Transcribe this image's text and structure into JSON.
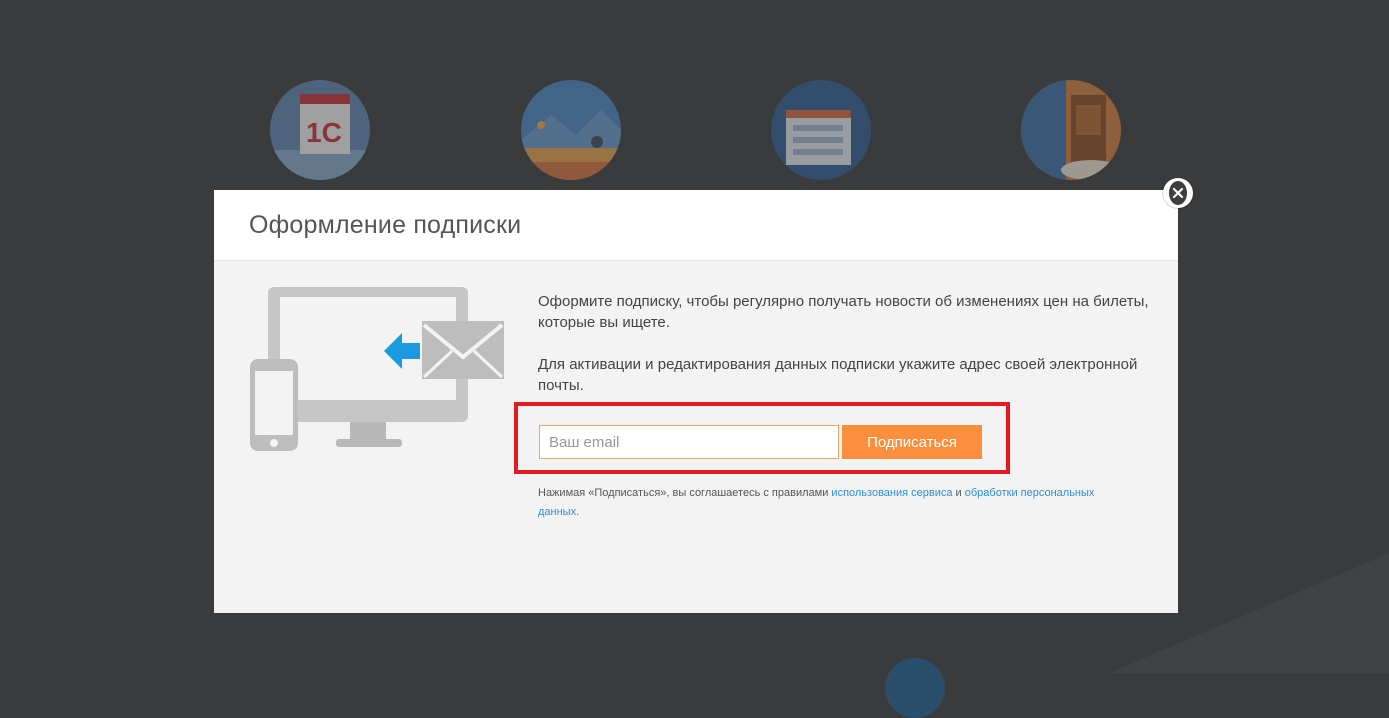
{
  "modal": {
    "title": "Оформление подписки",
    "paragraph_1": "Оформите подписку, чтобы регулярно получать новости об изменениях цен на билеты, которые вы ищете.",
    "paragraph_2": "Для активации и редактирования данных подписки укажите адрес своей электронной почты.",
    "email_placeholder": "Ваш email",
    "email_value": "",
    "subscribe_label": "Подписаться",
    "terms": {
      "prefix": "Нажимая «Подписаться», вы соглашаетесь с правилами ",
      "link_service": "использования сервиса",
      "middle": " и ",
      "link_personal": "обработки персональных данных",
      "suffix": "."
    }
  },
  "background": {
    "circle_labels": [
      "1С"
    ]
  },
  "icons": {
    "close": "close-icon",
    "illustration": "monitor-phone-mail-icon"
  },
  "colors": {
    "accent_button": "#fb8f3d",
    "input_border": "#f0a468",
    "highlight_border": "#e11b23",
    "link": "#2d8fd6",
    "arrow_blue": "#1a9be0",
    "overlay": "#3a3b3d"
  }
}
